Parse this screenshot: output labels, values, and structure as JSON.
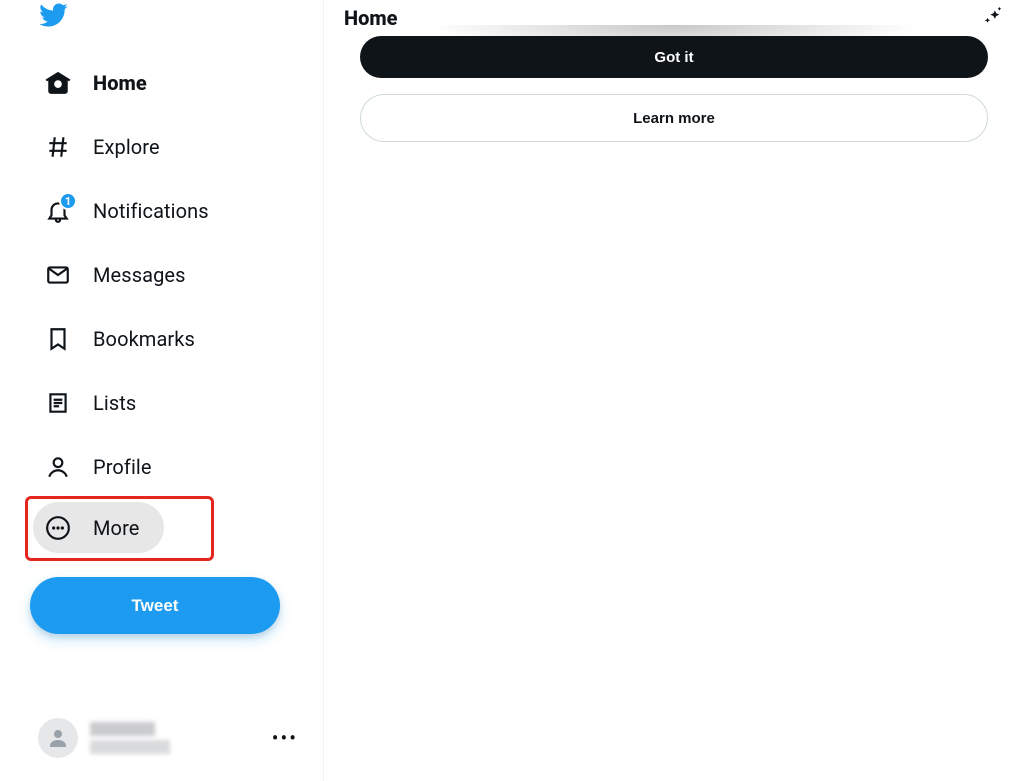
{
  "sidebar": {
    "nav": {
      "home": "Home",
      "explore": "Explore",
      "notifications": "Notifications",
      "notifications_badge": "1",
      "messages": "Messages",
      "bookmarks": "Bookmarks",
      "lists": "Lists",
      "profile": "Profile",
      "more": "More"
    },
    "tweet_button": "Tweet"
  },
  "header": {
    "title": "Home"
  },
  "prompt": {
    "primary_button": "Got it",
    "secondary_button": "Learn more"
  }
}
